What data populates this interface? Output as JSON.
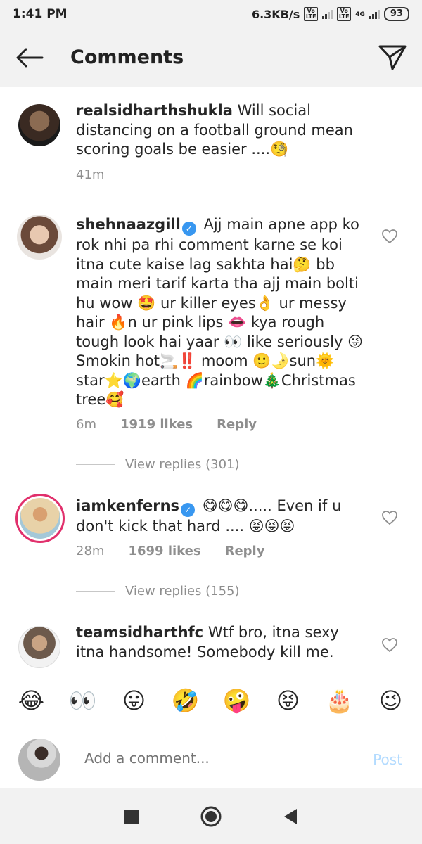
{
  "status_bar": {
    "time": "1:41 PM",
    "speed": "6.3KB/s",
    "volte1": "Vo LTE",
    "volte2": "Vo LTE",
    "network": "4G",
    "battery": "93"
  },
  "header": {
    "title": "Comments",
    "back_icon": "back-arrow-icon",
    "send_icon": "paper-plane-icon"
  },
  "comments": [
    {
      "username": "realsidharthshukla",
      "text": "Will social distancing on a football ground mean scoring  goals be easier ....🧐",
      "time": "41m"
    },
    {
      "username": "shehnaazgill",
      "verified": true,
      "text": "Ajj main apne app ko rok nhi pa rhi comment karne se koi itna cute kaise lag sakhta hai🤔 bb main meri tarif karta tha ajj main bolti hu wow 🤩 ur killer eyes👌 ur messy hair 🔥n ur pink lips 👄  kya rough tough look hai yaar 👀 like seriously 😜 Smokin hot🚬‼️ moom 🙂🌛sun🌞 star⭐🌍earth 🌈rainbow🎄Christmas tree🥰",
      "time": "6m",
      "likes": "1919 likes",
      "reply": "Reply",
      "view_replies": "View replies (301)"
    },
    {
      "username": "iamkenferns",
      "verified": true,
      "text": "😋😋😋..... Even if u don't kick that hard .... 😝😝😝",
      "time": "28m",
      "likes": "1699 likes",
      "reply": "Reply",
      "view_replies": "View replies (155)"
    },
    {
      "username": "teamsidharthfc",
      "text": "Wtf bro, itna sexy itna handsome! Somebody kill me."
    }
  ],
  "emoji_bar": [
    "😂",
    "👀",
    "😛",
    "🤣",
    "🤪",
    "😝",
    "🎂",
    "😉"
  ],
  "add_comment": {
    "placeholder": "Add a comment...",
    "post_label": "Post"
  },
  "colors": {
    "verified": "#3897f0",
    "post_disabled": "#b3dbff",
    "meta_text": "#8e8e8e"
  }
}
